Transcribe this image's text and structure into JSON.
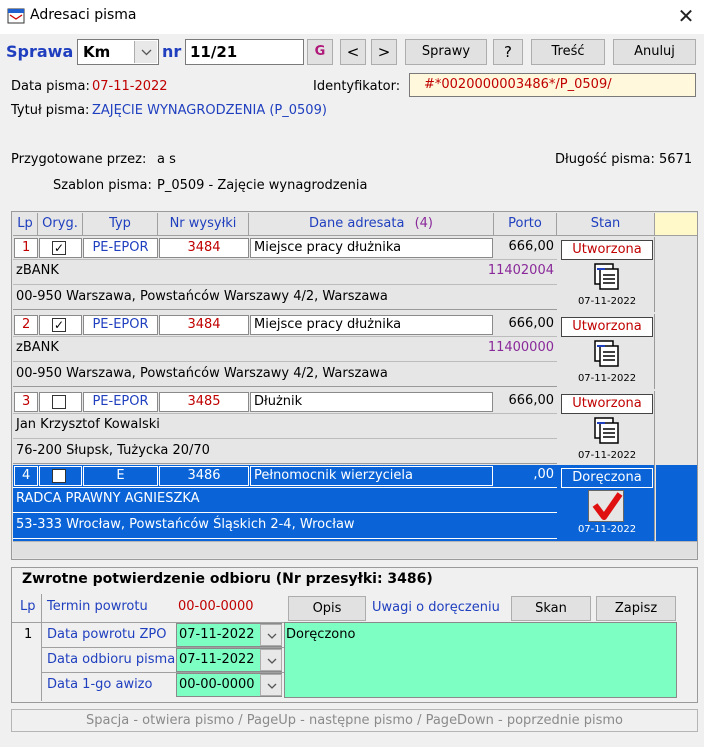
{
  "window": {
    "title": "Adresaci pisma"
  },
  "toolbar": {
    "sprawa_label": "Sprawa",
    "km_value": "Km",
    "nr_label": "nr",
    "nr_value": "11/21",
    "g_label": "G",
    "prev_label": "<",
    "next_label": ">",
    "sprawy_label": "Sprawy",
    "help_label": "?",
    "tresc_label": "Treść",
    "anuluj_label": "Anuluj"
  },
  "info": {
    "data_label": "Data pisma:",
    "data_value": "07-11-2022",
    "ident_label": "Identyfikator:",
    "ident_value": "#*0020000003486*/P_0509/",
    "tytul_label": "Tytuł pisma:",
    "tytul_value": "ZAJĘCIE WYNAGRODZENIA (P_0509)",
    "przyg_label": "Przygotowane przez:",
    "przyg_value": "a s",
    "dlugosc_label": "Długość pisma:",
    "dlugosc_value": "5671",
    "szablon_label": "Szablon pisma:",
    "szablon_value": "P_0509 - Zajęcie wynagrodzenia"
  },
  "table": {
    "headers": [
      "Lp",
      "Oryg.",
      "Typ",
      "Nr wysyłki",
      "Dane adresata",
      "(4)",
      "Porto",
      "Stan"
    ],
    "rows": [
      {
        "lp": "1",
        "checked": true,
        "typ": "PE-EPOR",
        "nr": "3484",
        "dane": "Miejsce pracy dłużnika",
        "porto": "666,00",
        "line2": "zBANK",
        "code": "11402004",
        "line3": "00-950 Warszawa, Powstańców Warszawy 4/2, Warszawa",
        "stan": "Utworzona",
        "date": "07-11-2022"
      },
      {
        "lp": "2",
        "checked": true,
        "typ": "PE-EPOR",
        "nr": "3484",
        "dane": "Miejsce pracy dłużnika",
        "porto": "666,00",
        "line2": "zBANK",
        "code": "11400000",
        "line3": "00-950 Warszawa, Powstańców Warszawy 4/2, Warszawa",
        "stan": "Utworzona",
        "date": "07-11-2022"
      },
      {
        "lp": "3",
        "checked": false,
        "typ": "PE-EPOR",
        "nr": "3485",
        "dane": "Dłużnik",
        "porto": "666,00",
        "line2": "Jan Krzysztof Kowalski",
        "code": "",
        "line3": "76-200 Słupsk, Tużycka 20/70",
        "stan": "Utworzona",
        "date": "07-11-2022"
      },
      {
        "lp": "4",
        "checked": false,
        "typ": "E",
        "nr": "3486",
        "dane": "Pełnomocnik wierzyciela",
        "porto": ",00",
        "line2": "RADCA PRAWNY AGNIESZKA",
        "code": "",
        "line3": "53-333 Wrocław, Powstańców Śląskich 2-4, Wrocław",
        "stan": "Doręczona",
        "date": "07-11-2022"
      }
    ]
  },
  "zpo": {
    "title": "Zwrotne potwierdzenie odbioru",
    "subtitle": "(Nr przesyłki: 3486)",
    "lp_label": "Lp",
    "termin_label": "Termin powrotu",
    "termin_value": "00-00-0000",
    "opis_label": "Opis",
    "uwagi_label": "Uwagi o doręczeniu",
    "skan_label": "Skan",
    "zapisz_label": "Zapisz",
    "row_lp": "1",
    "powrot_label": "Data powrotu ZPO",
    "powrot_value": "07-11-2022",
    "odbior_label": "Data odbioru pisma",
    "odbior_value": "07-11-2022",
    "awizo_label": "Data 1-go awizo",
    "awizo_value": "00-00-0000",
    "uwagi_value": "Doręczono"
  },
  "status": {
    "text": "Spacja - otwiera pismo  /  PageUp - następne pismo  /  PageDown - poprzednie pismo"
  },
  "colors": {
    "selection": "#0a64d8",
    "green": "#7dffc4",
    "red": "#c00000",
    "blue": "#1f3fbf"
  }
}
